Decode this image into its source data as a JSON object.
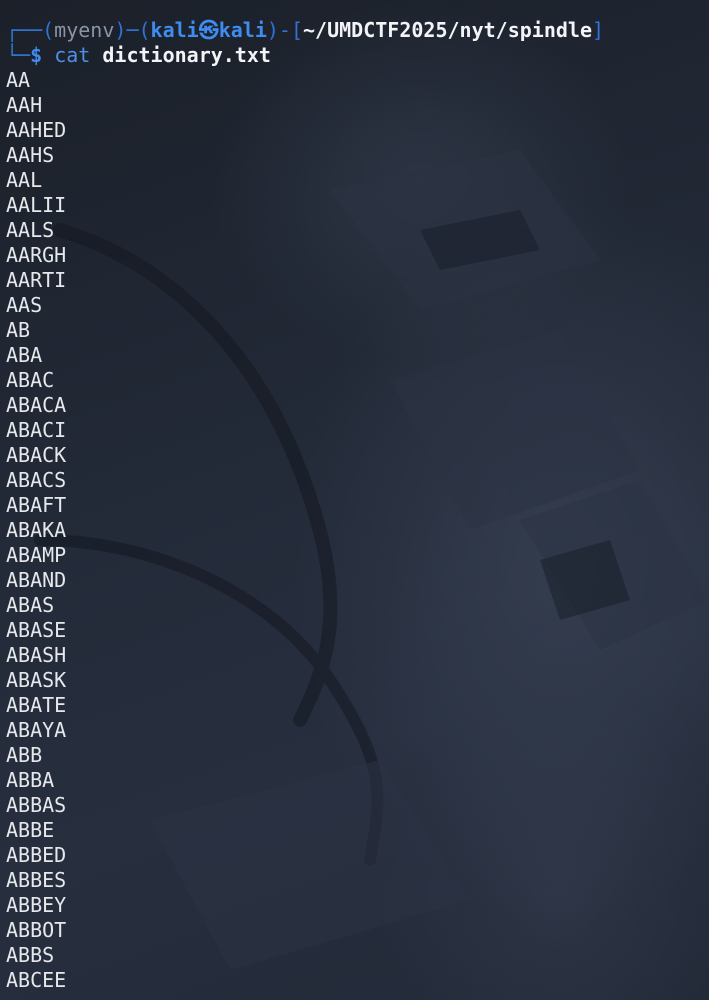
{
  "prompt": {
    "corner_top": "┌──",
    "open_paren": "(",
    "env": "myenv",
    "close_paren": ")",
    "dash": "─",
    "open_paren2": "(",
    "user": "kali",
    "symbol": "㉿",
    "host": "kali",
    "close_paren2": ")",
    "dash2": "-",
    "open_bracket": "[",
    "cwd": "~/UMDCTF2025/nyt/spindle",
    "close_bracket": "]",
    "corner_bottom": "└─",
    "dollar": "$",
    "command": "cat",
    "argument": "dictionary.txt"
  },
  "output": [
    "AA",
    "AAH",
    "AAHED",
    "AAHS",
    "AAL",
    "AALII",
    "AALS",
    "AARGH",
    "AARTI",
    "AAS",
    "AB",
    "ABA",
    "ABAC",
    "ABACA",
    "ABACI",
    "ABACK",
    "ABACS",
    "ABAFT",
    "ABAKA",
    "ABAMP",
    "ABAND",
    "ABAS",
    "ABASE",
    "ABASH",
    "ABASK",
    "ABATE",
    "ABAYA",
    "ABB",
    "ABBA",
    "ABBAS",
    "ABBE",
    "ABBED",
    "ABBES",
    "ABBEY",
    "ABBOT",
    "ABBS",
    "ABCEE"
  ],
  "colors": {
    "background": "#1d2230",
    "prompt_blue": "#2f73d6",
    "user_blue": "#3f8cf0",
    "text": "#e8eaee"
  }
}
